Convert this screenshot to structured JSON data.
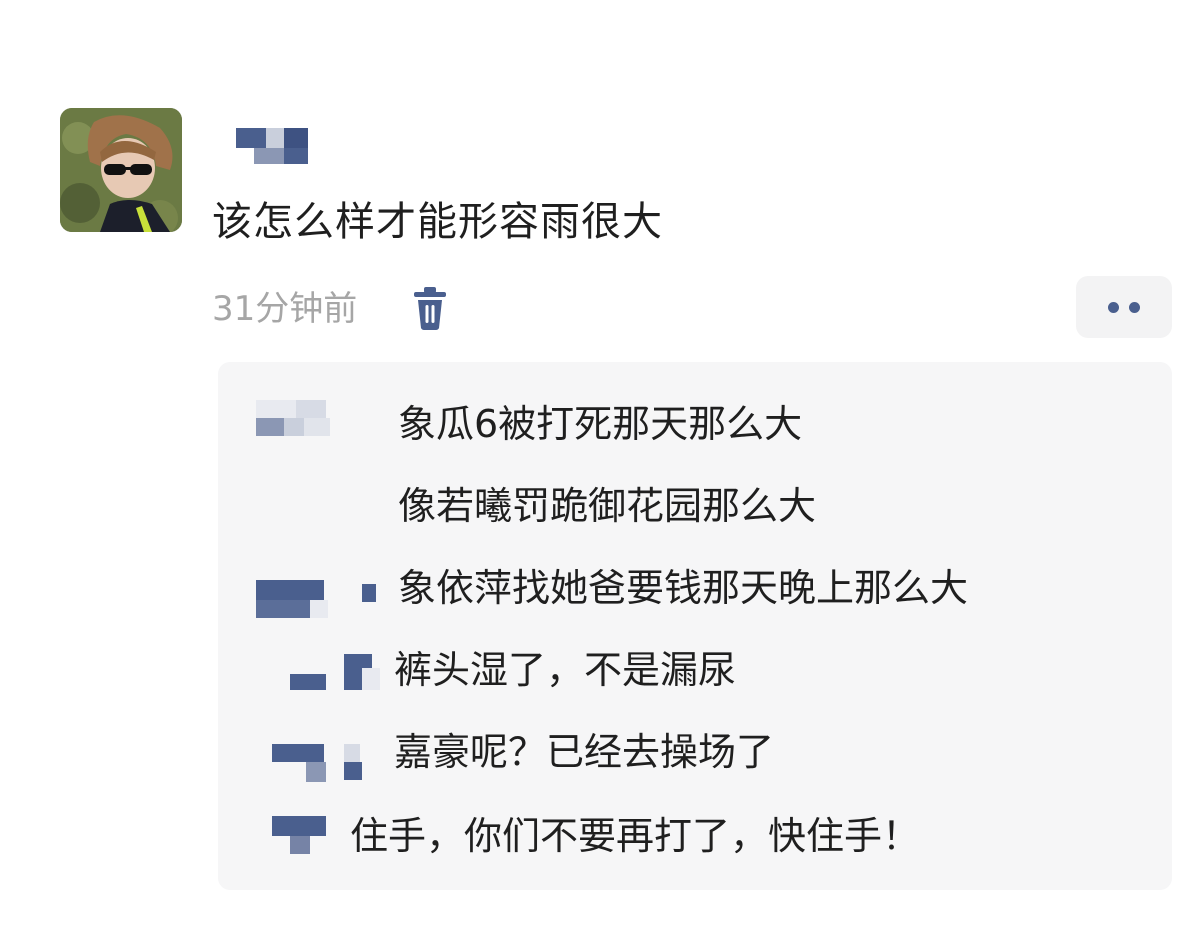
{
  "post": {
    "text": "该怎么样才能形容雨很大",
    "time": "31分钟前",
    "delete_icon": "trash-icon",
    "more_icon": "more-dots-icon",
    "username_hidden": true
  },
  "comments": [
    {
      "text": "象瓜6被打死那天那么大"
    },
    {
      "text": "像若曦罚跪御花园那么大"
    },
    {
      "text": "象依萍找她爸要钱那天晚上那么大"
    },
    {
      "text": "裤头湿了，不是漏尿"
    },
    {
      "text": "嘉豪呢？已经去操场了"
    },
    {
      "text": "住手，你们不要再打了，快住手！"
    }
  ],
  "colors": {
    "text": "#1f1f1f",
    "time": "#a6a6a6",
    "accent": "#4a5f8e",
    "comment_bg": "#f6f6f7"
  }
}
